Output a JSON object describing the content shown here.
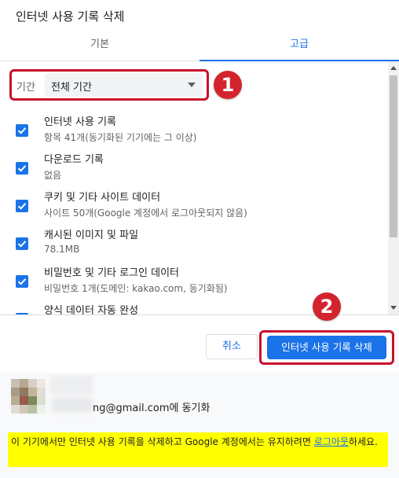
{
  "dialog": {
    "title": "인터넷 사용 기록 삭제"
  },
  "tabs": [
    {
      "label": "기본",
      "selected": false
    },
    {
      "label": "고급",
      "selected": true
    }
  ],
  "time_range": {
    "label": "기간",
    "value": "전체 기간"
  },
  "badges": [
    "1",
    "2"
  ],
  "items": [
    {
      "title": "인터넷 사용 기록",
      "sub": "항목 41개(동기화된 기기에는 그 이상)",
      "checked": true
    },
    {
      "title": "다운로드 기록",
      "sub": "없음",
      "checked": true
    },
    {
      "title": "쿠키 및 기타 사이트 데이터",
      "sub": "사이트 50개(Google 계정에서 로그아웃되지 않음)",
      "checked": true
    },
    {
      "title": "캐시된 이미지 및 파일",
      "sub": "78.1MB",
      "checked": true
    },
    {
      "title": "비밀번호 및 기타 로그인 데이터",
      "sub": "비밀번호 1개(도메인: kakao.com, 동기화됨)",
      "checked": true
    },
    {
      "title": "양식 데이터 자동 완성",
      "sub": "",
      "checked": true
    }
  ],
  "buttons": {
    "cancel": "취소",
    "confirm": "인터넷 사용 기록 삭제"
  },
  "sync": {
    "email_suffix": "ng@gmail.com에 동기화"
  },
  "notice": {
    "text_before": "이 기기에서만 인터넷 사용 기록을 삭제하고 Google 계정에서는 유지하려면 ",
    "link": "로그아웃",
    "text_after": "하세요."
  },
  "colors": {
    "accent": "#1a73e8",
    "highlight_border": "#c8102e",
    "badge": "#d3242e",
    "notice_bg": "#ffff00"
  }
}
